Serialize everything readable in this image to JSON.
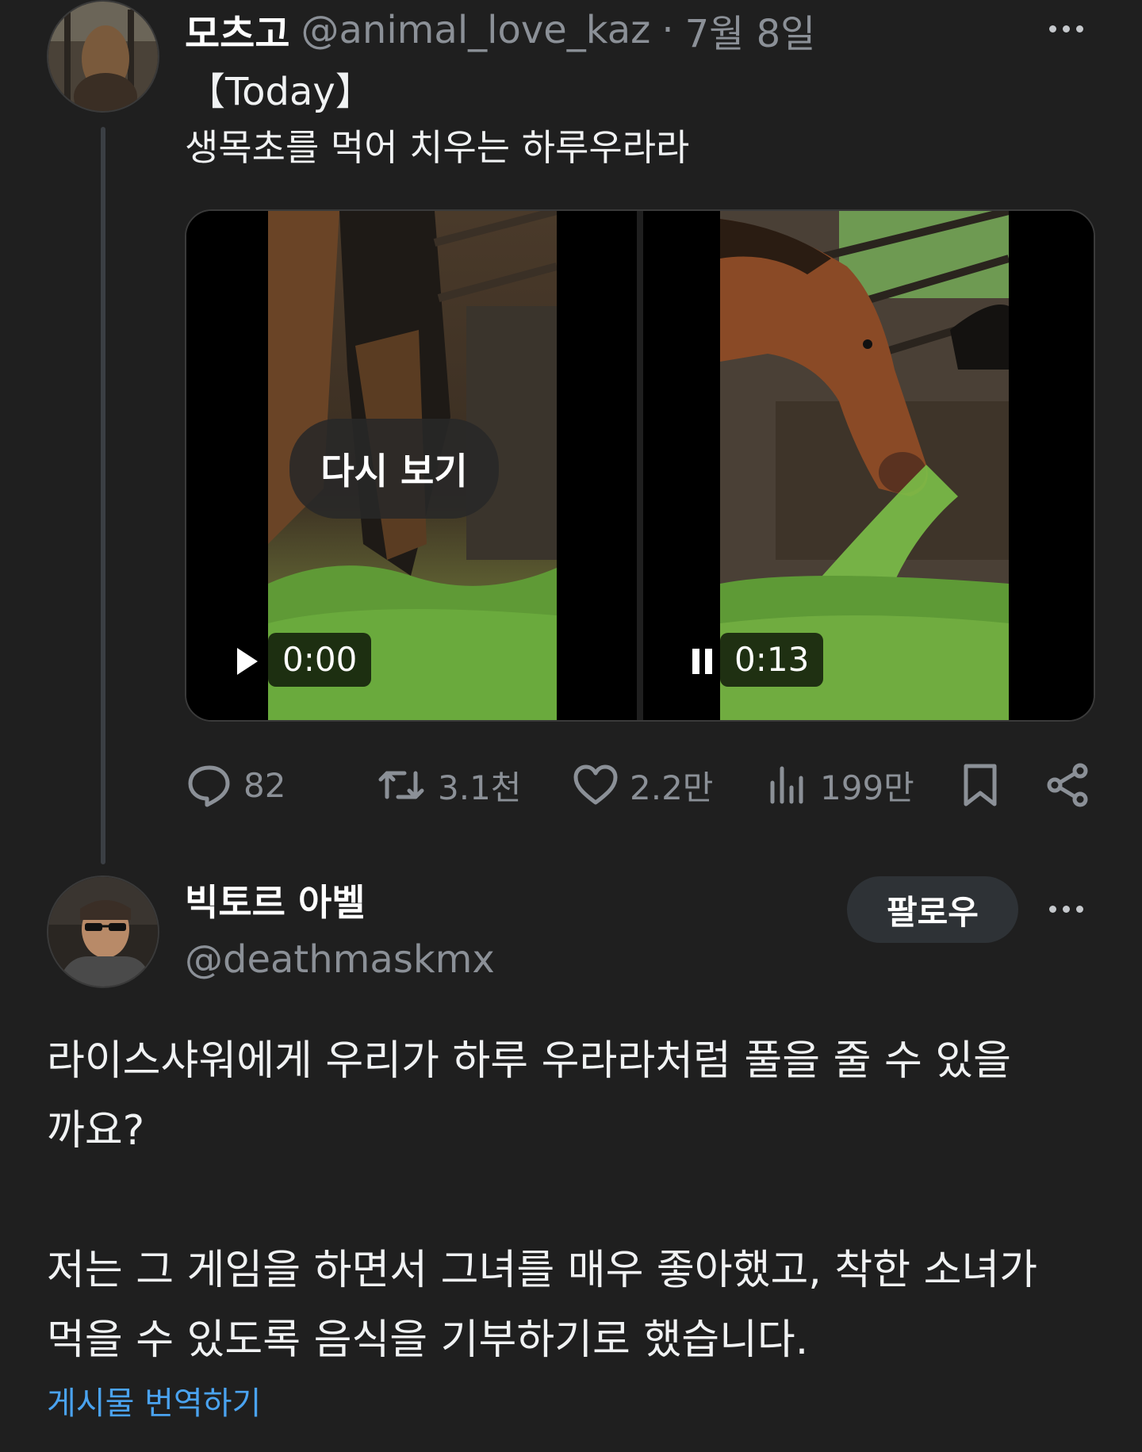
{
  "original_post": {
    "display_name": "모츠고",
    "handle": "@animal_love_kaz",
    "separator": "·",
    "date": "7월 8일",
    "line1": "【Today】",
    "line2": "생목초를 먹어 치우는 하루우라라",
    "videos": [
      {
        "state": "play-icon",
        "time": "0:00",
        "overlay": "다시 보기"
      },
      {
        "state": "pause-icon",
        "time": "0:13"
      }
    ],
    "stats": {
      "replies": "82",
      "reposts": "3.1천",
      "likes": "2.2만",
      "views": "199만"
    }
  },
  "reply": {
    "display_name": "빅토르 아벨",
    "handle": "@deathmaskmx",
    "follow_label": "팔로우",
    "paragraph1_line1": "라이스샤워에게 우리가 하루 우라라처럼 풀을 줄 수 있을",
    "paragraph1_line2": "까요?",
    "paragraph2_line1": "저는 그 게임을 하면서 그녀를 매우 좋아했고, 착한 소녀가",
    "paragraph2_line2": "먹을 수 있도록 음식을 기부하기로 했습니다.",
    "translate_label": "게시물 번역하기"
  },
  "colors": {
    "background": "#1f1f1f",
    "text": "#e7e9ea",
    "muted": "#8b9097",
    "link": "#4aa3f0",
    "button_bg": "#2e3236"
  }
}
